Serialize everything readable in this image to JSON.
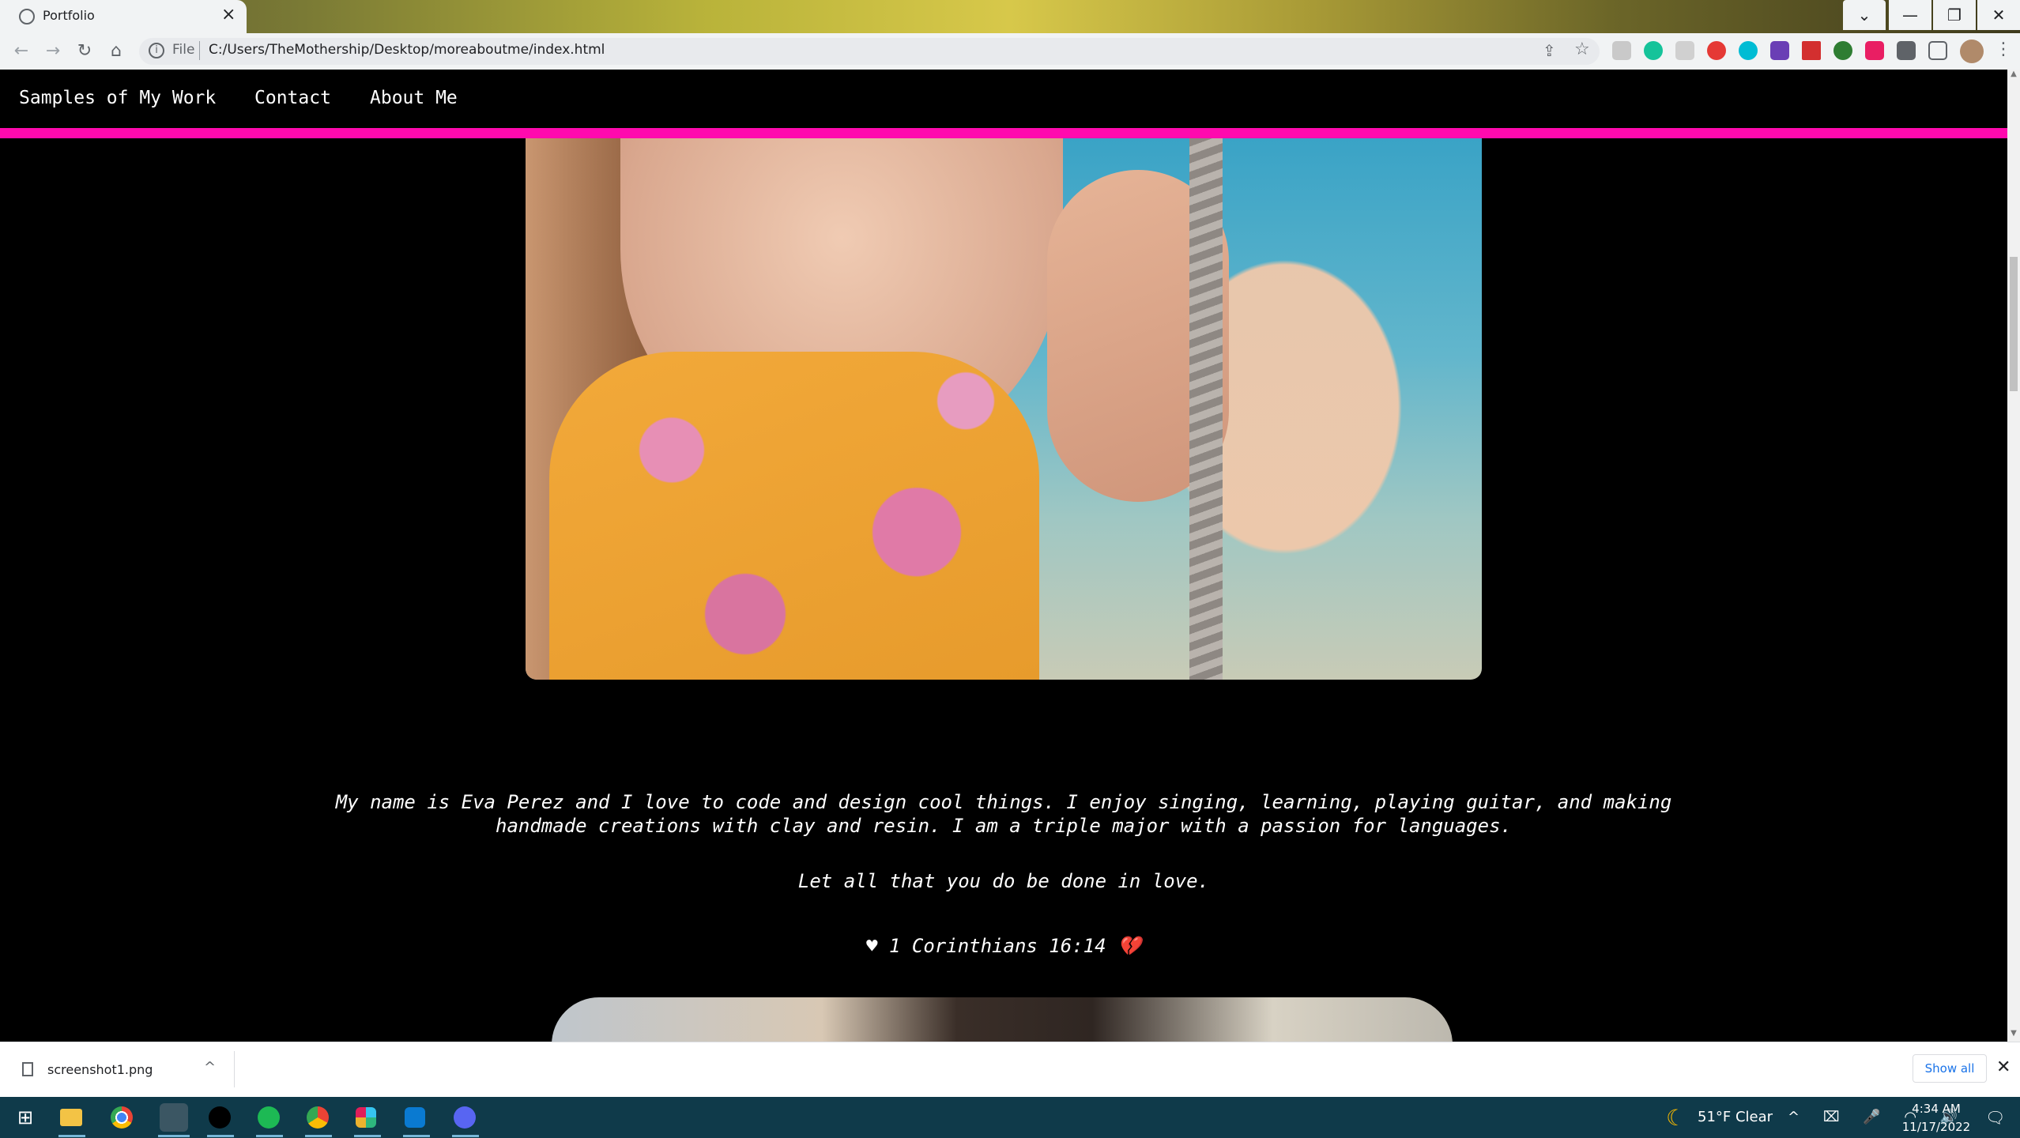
{
  "browser": {
    "tab_title": "Portfolio",
    "tab_close": "×",
    "address_scheme_label": "File",
    "url": "C:/Users/TheMothership/Desktop/moreaboutme/index.html",
    "window_chevron": "⌄",
    "window_minimize": "—",
    "window_restore": "❐",
    "window_close": "✕",
    "back": "←",
    "forward": "→",
    "reload": "↻",
    "home": "⌂",
    "share": "⇪",
    "bookmark": "☆",
    "menu": "⋮"
  },
  "navbar": {
    "links": [
      {
        "label": "Samples of My Work"
      },
      {
        "label": "Contact"
      },
      {
        "label": "About Me"
      }
    ],
    "underline_color": "#ff0aae"
  },
  "about": {
    "bio": "My name is Eva Perez and I love to code and design cool things. I enjoy singing, learning, playing guitar, and making handmade creations with clay and resin. I am a triple major with a passion for languages.",
    "motto": "Let all that you do be done in love.",
    "verse_heart_left": "♥",
    "verse": "1 Corinthians 16:14",
    "verse_heart_right": "💔"
  },
  "download_bar": {
    "file_name": "screenshot1.png",
    "chevron": "^",
    "show_all": "Show all",
    "close": "✕"
  },
  "taskbar": {
    "weather": "51°F  Clear",
    "time": "4:34 AM",
    "date": "11/17/2022",
    "tray_icons": "^ ⌧ 🎤 ◠ 🔊"
  }
}
